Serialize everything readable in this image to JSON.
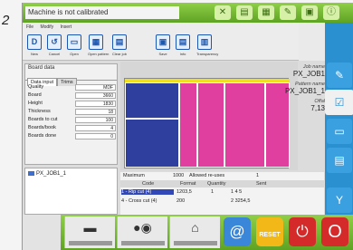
{
  "figure_number": "2",
  "status_message": "Machine is not calibrated",
  "menu": [
    "File",
    "Modify",
    "Insert"
  ],
  "toolbar": [
    {
      "label": "New",
      "glyph": "D"
    },
    {
      "label": "Cancel",
      "glyph": "↺"
    },
    {
      "label": "Open",
      "glyph": "▭"
    },
    {
      "label": "Open pattern",
      "glyph": "▦"
    },
    {
      "label": "Clear job",
      "glyph": "▤"
    },
    {
      "label": "Save",
      "glyph": "▣"
    },
    {
      "label": "Info",
      "glyph": "▤"
    },
    {
      "label": "Transparency",
      "glyph": "▥"
    }
  ],
  "board_panel": {
    "title": "Board data",
    "tabs": [
      "Data input",
      "Trims"
    ],
    "fields": [
      {
        "label": "Quality",
        "value": "MDF"
      },
      {
        "label": "Board",
        "value": "3660"
      },
      {
        "label": "Height",
        "value": "1830"
      },
      {
        "label": "Thickness",
        "value": "18"
      },
      {
        "label": "Boards to cut",
        "value": "100"
      },
      {
        "label": "Boards/book",
        "value": "4"
      },
      {
        "label": "Boards done",
        "value": "0"
      }
    ]
  },
  "tree": {
    "item": "PX_JOB1_1"
  },
  "job_info": {
    "job_name_label": "Job name",
    "job_name": "PX_JOB1",
    "pattern_label": "Pattern name",
    "pattern_name": "PX_JOB1_1",
    "offal_label": "Offal",
    "offal_value": "7,13"
  },
  "table": {
    "max_label": "Maximum",
    "max_value": "1000",
    "allowed_label": "Allowed re-uses",
    "allowed_value": "1",
    "headers": [
      "Code",
      "Format",
      "Quantity",
      "Sent"
    ],
    "rows": [
      {
        "code": "1 - Rip cut (4)",
        "format": "1203,5",
        "quantity": "1",
        "sent": "1 4 5"
      },
      {
        "code": "4 - Cross cut (4)",
        "format": "200",
        "quantity": "",
        "sent": "2 3254,5"
      }
    ]
  },
  "sidebar_buttons": [
    "pencil-icon",
    "checklist-icon",
    "ruler-icon",
    "layout-icon",
    "wrench-icon"
  ],
  "bottom_bar": {
    "reset_label": "RESET"
  },
  "colors": {
    "green": "#6db62c",
    "blue": "#2b90d0",
    "pink": "#e13fa0",
    "navy": "#2e3f9e",
    "yellow": "#f0e020",
    "red": "#d42a2a"
  }
}
